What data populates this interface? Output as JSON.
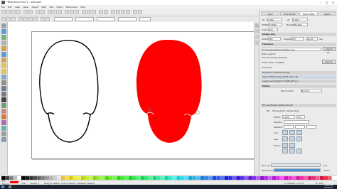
{
  "window": {
    "title": "*New document 1 - Inkscape",
    "minimize": "–",
    "maximize": "□",
    "close": "✕"
  },
  "menu": [
    "File",
    "Edit",
    "View",
    "Layer",
    "Object",
    "Path",
    "Text",
    "Filters",
    "Extensions",
    "Help"
  ],
  "dock": {
    "tabs": [
      "Align",
      "Fill & Stroke",
      "Export PNG",
      "Object"
    ],
    "export_area": {
      "x0_label": "x0:",
      "x0": "0.000",
      "y0_label": "y0:",
      "y0": "0.000",
      "width_label": "Width:",
      "width": "74.680",
      "height_label": "Height:",
      "height": "80.000",
      "units_label": "Units:",
      "units": "mm"
    },
    "image_size": {
      "heading": "Image size",
      "width_label": "Width:",
      "width": "282",
      "height_label": "Height:",
      "height": "302",
      "dpi_label": "dpi",
      "dpi": "96.00"
    },
    "filename": {
      "heading": "Filename",
      "value": "C:\\Users\\Desktop\\Untitled.png",
      "export_as": "Export As...",
      "export": "Export"
    },
    "options": {
      "batch": "Batch export",
      "hide": "Hide all except selected",
      "close": "Close when complete",
      "advanced": "Advanced"
    },
    "objects": [
      "Transform (Shift+Ctrl+M)",
      "Export PNG Image (Shift+Ctrl+E)",
      "Layers and Objects (Shift+Ctrl+L)"
    ],
    "modes_heading": "Modes",
    "blend_label": "Blend mode",
    "blend_value": "Normal",
    "fill_stroke": {
      "title": "Fill and Stroke (Shift+Ctrl+F)",
      "tabs": [
        "Fill",
        "Stroke paint",
        "Stroke style"
      ],
      "width_label": "Width:",
      "width": "1.000",
      "width_unit": "mm",
      "dashes_label": "Dashes:",
      "markers_label": "Markers:",
      "join_label": "Join:",
      "cap_label": "Cap:",
      "order_label": "Order:"
    },
    "blur_label": "Blur (%)",
    "blur_value": "0.0",
    "opacity_label": "Opacity (%)",
    "opacity_value": "100.0"
  },
  "status": {
    "fill_label": "Fill:",
    "stroke_label": "Stroke:",
    "opacity": "100",
    "layer": "•Layer 1",
    "message": "Drag to select, click to select / deselect objects.",
    "coords": "X: 140.65  Y: 47.37",
    "zoom": "Z: 54%"
  },
  "clock": {
    "time": "6:08 PM",
    "date": "1/4/2019"
  },
  "colors": {
    "red_fill": "#ff0000",
    "outline": "#000000",
    "accent": "#4a90d9",
    "taskbar": "#1b2330"
  },
  "canvas_objects": [
    {
      "name": "skull-outline",
      "fill": "none",
      "stroke": "#000000"
    },
    {
      "name": "skull-red",
      "fill": "#ff0000",
      "stroke": "none"
    }
  ]
}
